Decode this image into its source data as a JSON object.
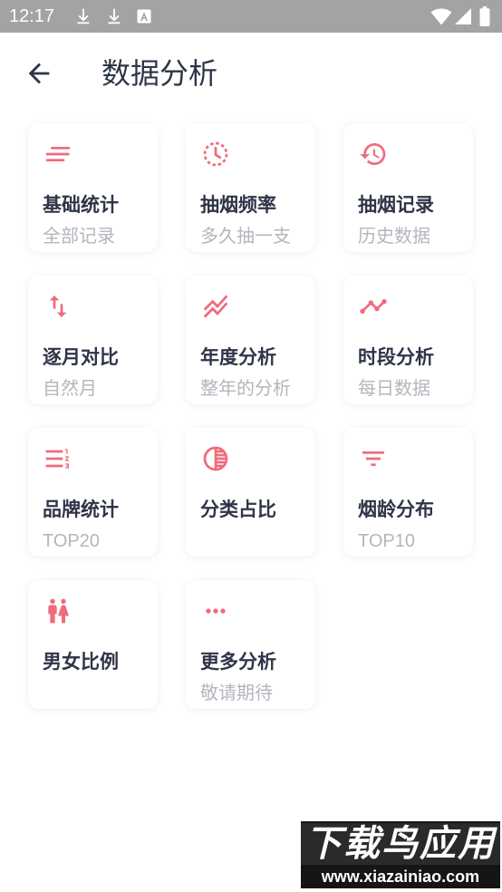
{
  "status_bar": {
    "time": "12:17",
    "left_icons": [
      "download-icon",
      "download-icon",
      "text-a-icon"
    ],
    "right_icons": [
      "wifi-icon",
      "signal-icon",
      "battery-icon"
    ]
  },
  "header": {
    "back_icon": "arrow-back-icon",
    "title": "数据分析"
  },
  "colors": {
    "accent": "#ef6b7b",
    "title_text": "#2f3548",
    "subtitle_text": "#b3b6bd",
    "status_bar": "#a3a3a3"
  },
  "cards": [
    {
      "icon": "notes-icon",
      "title": "基础统计",
      "subtitle": "全部记录"
    },
    {
      "icon": "dashed-clock-icon",
      "title": "抽烟频率",
      "subtitle": "多久抽一支"
    },
    {
      "icon": "history-icon",
      "title": "抽烟记录",
      "subtitle": "历史数据"
    },
    {
      "icon": "swap-vertical-icon",
      "title": "逐月对比",
      "subtitle": "自然月"
    },
    {
      "icon": "stacked-line-chart-icon",
      "title": "年度分析",
      "subtitle": "整年的分析"
    },
    {
      "icon": "timeline-icon",
      "title": "时段分析",
      "subtitle": "每日数据"
    },
    {
      "icon": "numbered-list-icon",
      "title": "品牌统计",
      "subtitle": "TOP20"
    },
    {
      "icon": "contrast-icon",
      "title": "分类占比"
    },
    {
      "icon": "filter-list-icon",
      "title": "烟龄分布",
      "subtitle": "TOP10"
    },
    {
      "icon": "man-woman-icon",
      "title": "男女比例"
    },
    {
      "icon": "more-horizontal-icon",
      "title": "更多分析",
      "subtitle": "敬请期待"
    }
  ],
  "watermark": {
    "brand": "下载鸟应用",
    "url": "www.xiazainiao.com"
  }
}
